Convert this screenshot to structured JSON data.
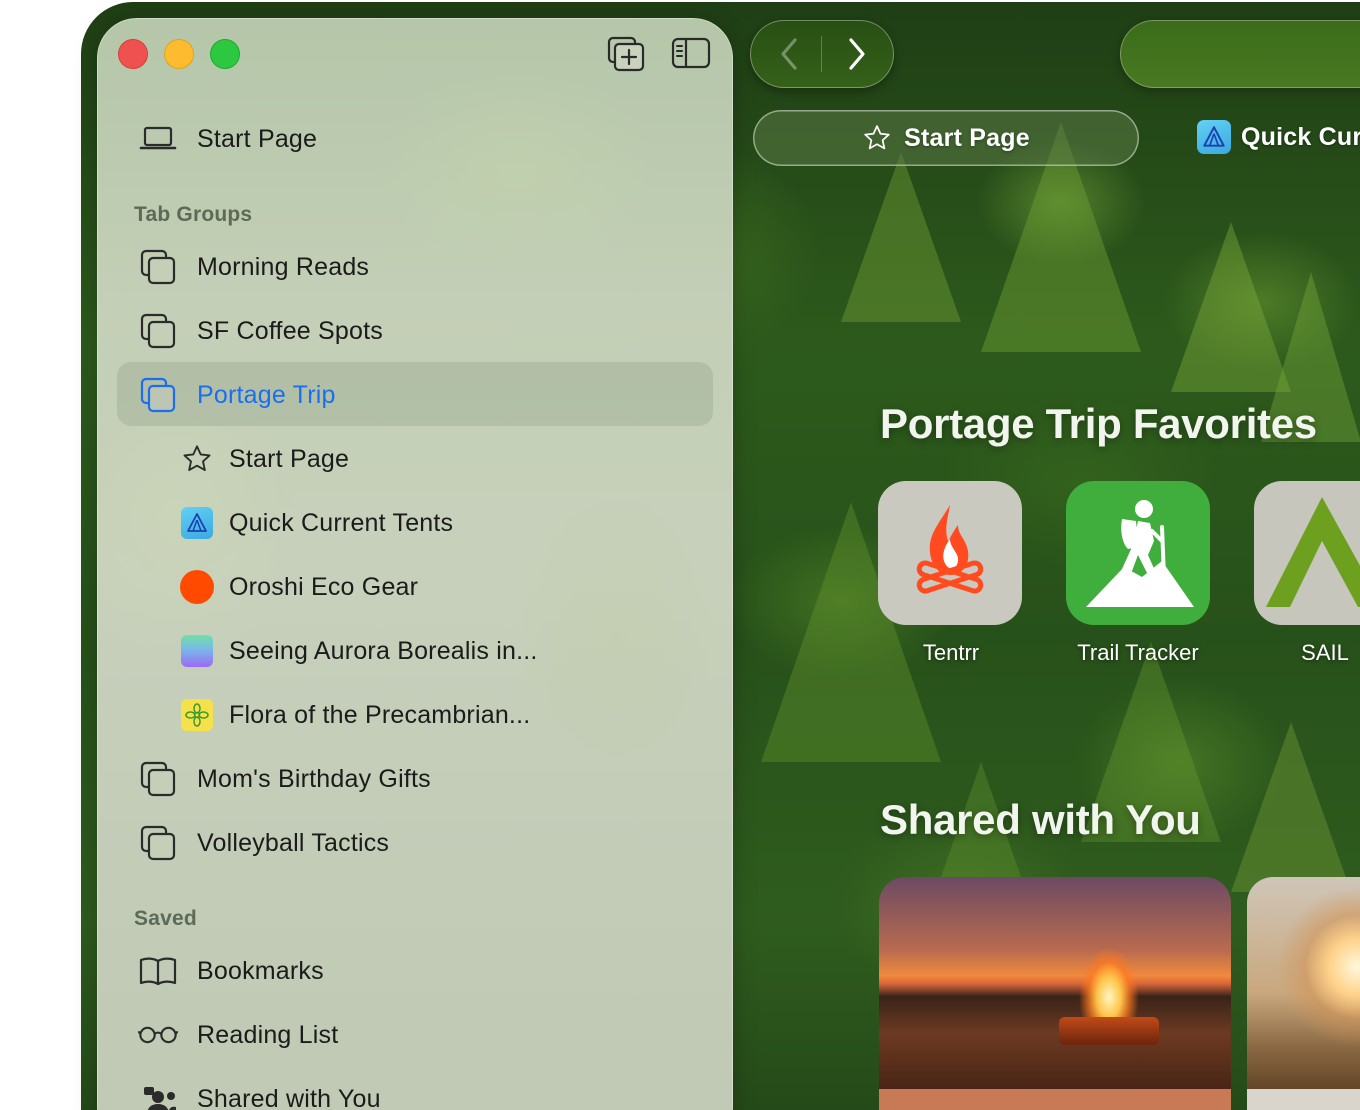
{
  "window": {
    "traffic_lights": [
      "close",
      "minimize",
      "zoom"
    ]
  },
  "sidebar": {
    "toolbar_icons": [
      "new-tab-group-icon",
      "sidebar-toggle-icon"
    ],
    "start_page": {
      "label": "Start Page",
      "icon": "laptop-icon"
    },
    "tab_groups_header": "Tab Groups",
    "tab_groups": [
      {
        "label": "Morning Reads",
        "icon": "tab-group-icon"
      },
      {
        "label": "SF Coffee Spots",
        "icon": "tab-group-icon"
      },
      {
        "label": "Portage Trip",
        "icon": "tab-group-icon",
        "selected": true,
        "accent": "#1a6ff0"
      },
      {
        "label": "Mom's Birthday Gifts",
        "icon": "tab-group-icon"
      },
      {
        "label": "Volleyball Tactics",
        "icon": "tab-group-icon"
      }
    ],
    "portage_tabs": [
      {
        "label": "Start Page",
        "icon": "star-icon"
      },
      {
        "label": "Quick Current Tents",
        "icon": "tent-favicon",
        "color": "#4ab8e8"
      },
      {
        "label": "Oroshi Eco Gear",
        "icon": "orange-circle-favicon",
        "color": "#ff4a00"
      },
      {
        "label": "Seeing Aurora Borealis in...",
        "icon": "gradient-favicon",
        "color": "#9b6bf5"
      },
      {
        "label": "Flora of the Precambrian...",
        "icon": "flower-favicon",
        "color": "#f5e14a"
      }
    ],
    "saved_header": "Saved",
    "saved": [
      {
        "label": "Bookmarks",
        "icon": "book-icon"
      },
      {
        "label": "Reading List",
        "icon": "glasses-icon"
      },
      {
        "label": "Shared with You",
        "icon": "people-icon"
      }
    ]
  },
  "toolbar": {
    "back_icon": "chevron-left-icon",
    "forward_icon": "chevron-right-icon",
    "tabs": [
      {
        "label": "Start Page",
        "icon": "star-icon",
        "active": true
      },
      {
        "label": "Quick Cur",
        "icon": "tent-favicon"
      }
    ]
  },
  "content": {
    "favorites_title": "Portage Trip Favorites",
    "favorites": [
      {
        "label": "Tentrr",
        "icon": "campfire-icon",
        "bg": "#c9c9c0"
      },
      {
        "label": "Trail Tracker",
        "icon": "hiker-icon",
        "bg": "#3fae3c"
      },
      {
        "label": "SAIL",
        "icon": "sail-logo-icon",
        "bg": "#c6c6bc"
      }
    ],
    "shared_title": "Shared with You",
    "shared_cards": [
      {
        "image": "campfire-photo"
      },
      {
        "image": "sunset-photo"
      }
    ]
  }
}
